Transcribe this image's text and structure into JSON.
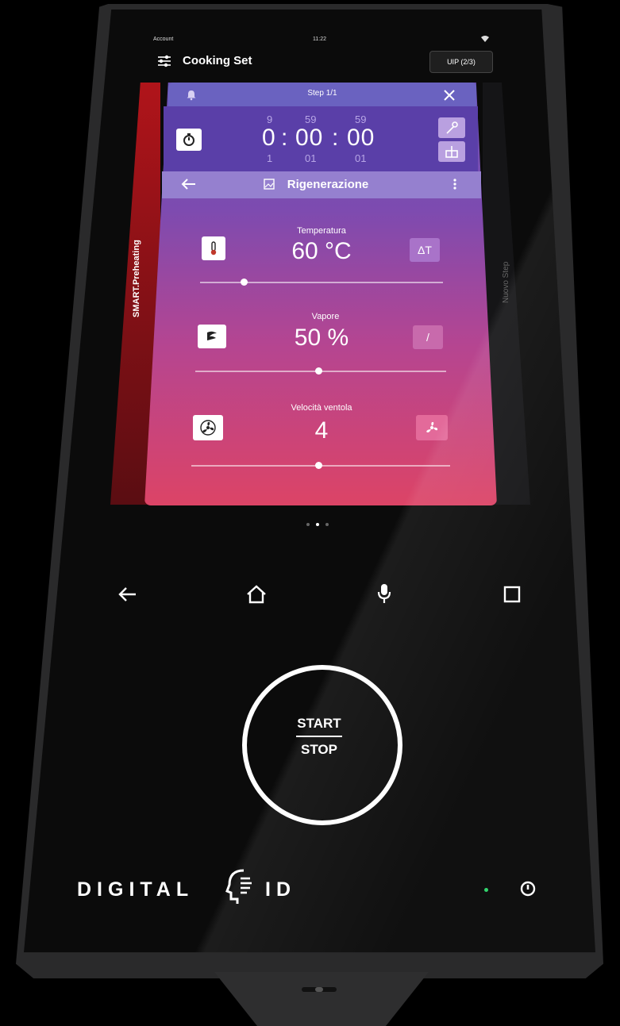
{
  "status_bar": {
    "account": "Account",
    "time": "11:22",
    "wifi_icon": "wifi-icon"
  },
  "header": {
    "title": "Cooking Set",
    "uip_label": "UIP (2/3)"
  },
  "side_panels": {
    "left_label": "SMART.Preheating",
    "right_label": "Nuovo Step"
  },
  "card": {
    "step_title": "Step 1/1",
    "close_icon": "close-icon",
    "timer": {
      "top": [
        "9",
        "59",
        "59"
      ],
      "main": [
        "0",
        "00",
        "00"
      ],
      "bottom": [
        "1",
        "01",
        "01"
      ],
      "separator": ":"
    },
    "recipe_title": "Rigenerazione",
    "params": [
      {
        "label": "Temperatura",
        "value": "60 °C",
        "right_icon_text": "ΔT",
        "slider_fraction": 0.18
      },
      {
        "label": "Vapore",
        "value": "50 %",
        "right_icon_text": "/",
        "slider_fraction": 0.49
      },
      {
        "label": "Velocità ventola",
        "value": "4",
        "slider_fraction": 0.49
      }
    ]
  },
  "pager": {
    "count": 3,
    "active": 1
  },
  "nav_bar": [
    "back-icon",
    "home-icon",
    "microphone-icon",
    "recents-icon"
  ],
  "start_stop": {
    "start": "START",
    "stop": "STOP"
  },
  "brand": {
    "left": "DIGITAL",
    "right": "ID"
  },
  "colors": {
    "accent_purple": "#6a52b6",
    "accent_pink": "#dc4466",
    "preheat_red": "#b0141a",
    "led_green": "#2ed46a"
  }
}
